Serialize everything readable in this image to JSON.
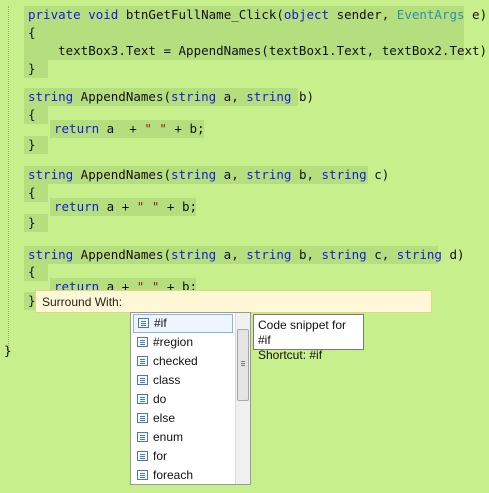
{
  "code": {
    "l1": {
      "kw1": "private",
      "kw2": "void",
      "name": "btnGetFullName_Click(",
      "kw3": "object",
      "p1": " sender, ",
      "ty": "EventArgs",
      "p2": " e)"
    },
    "l2": "{",
    "l3": "textBox3.Text = AppendNames(textBox1.Text, textBox2.Text);",
    "l4": "}",
    "m1": {
      "kw": "string",
      "name": " AppendNames(",
      "kw2": "string",
      "p1": " a, ",
      "kw3": "string",
      "p2": " b)"
    },
    "m1_open": "{",
    "m1_body": {
      "kw": "return",
      "a": " a  + ",
      "s": "\" \"",
      "b": " + b;"
    },
    "m1_close": "}",
    "m2": {
      "kw": "string",
      "name": " AppendNames(",
      "kw2": "string",
      "p1": " a, ",
      "kw3": "string",
      "p2": " b, ",
      "kw4": "string",
      "p3": " c)"
    },
    "m2_open": "{",
    "m2_body": {
      "kw": "return",
      "a": " a + ",
      "s": "\" \"",
      "b": " + b;"
    },
    "m2_close": "}",
    "m3": {
      "kw": "string",
      "name": " AppendNames(",
      "kw2": "string",
      "p1": " a, ",
      "kw3": "string",
      "p2": " b, ",
      "kw4": "string",
      "p3": " c, ",
      "kw5": "string",
      "p4": " d)"
    },
    "m3_open": "{",
    "m3_body": {
      "kw": "return",
      "a": " a + ",
      "s": "\" \"",
      "b": " + b;"
    },
    "m3_close": "}",
    "class_close": "}"
  },
  "surround": {
    "label": "Surround With:"
  },
  "snippets": [
    "#if",
    "#region",
    "checked",
    "class",
    "do",
    "else",
    "enum",
    "for",
    "foreach"
  ],
  "tooltip": {
    "line1": "Code snippet for #if",
    "line2": "Shortcut: #if"
  },
  "colors": {
    "background": "#c7ef8b",
    "keyword": "#1a18d8",
    "type": "#2b91af",
    "string": "#a31515"
  }
}
